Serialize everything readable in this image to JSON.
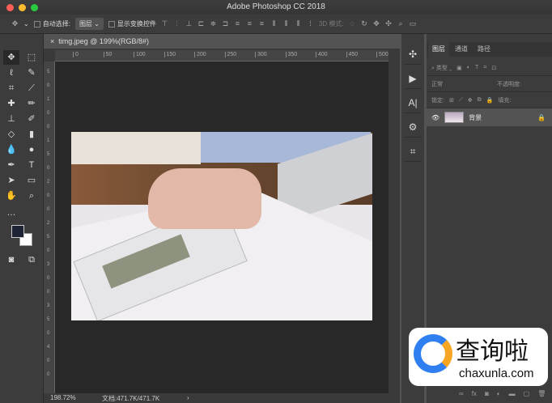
{
  "window": {
    "title": "Adobe Photoshop CC 2018",
    "lights": [
      "#fc5f57",
      "#fdbc2e",
      "#28c840"
    ]
  },
  "options": {
    "auto_select_label": "自动选择:",
    "auto_select_value": "图层",
    "show_transform_label": "显示变换控件",
    "mode_3d": "3D 模式:"
  },
  "document": {
    "tab_title": "timg.jpeg @ 199%(RGB/8#)",
    "close": "×"
  },
  "ruler_top": [
    "0",
    "50",
    "100",
    "150",
    "200",
    "250",
    "300",
    "350",
    "400",
    "450",
    "500"
  ],
  "ruler_left": [
    "5",
    "0",
    "1",
    "0",
    "0",
    "1",
    "5",
    "0",
    "2",
    "0",
    "0",
    "2",
    "5",
    "0",
    "3",
    "0",
    "0",
    "3",
    "5",
    "0",
    "4",
    "0",
    "0"
  ],
  "status": {
    "zoom": "198.72%",
    "doc": "文档:471.7K/471.7K",
    "arrow": "›"
  },
  "layers_panel": {
    "tabs": [
      "图层",
      "通道",
      "路径"
    ],
    "filter": "类型",
    "blend": "正常",
    "opacity_label": "不透明度:",
    "lock_label": "锁定:",
    "fill_label": "填充:",
    "layer_name": "背景"
  },
  "watermark": {
    "title": "查询啦",
    "url": "chaxunla.com"
  }
}
